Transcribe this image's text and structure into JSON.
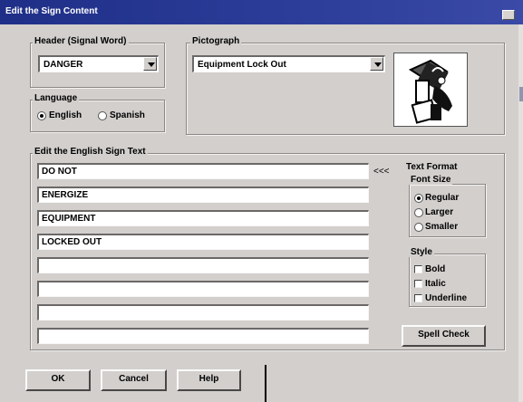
{
  "window": {
    "title": "Edit the Sign Content"
  },
  "header_group": {
    "label": "Header (Signal Word)",
    "value": "DANGER"
  },
  "pictograph_group": {
    "label": "Pictograph",
    "value": "Equipment Lock Out",
    "image_icon": "lockout-hand-padlock-icon"
  },
  "language_group": {
    "label": "Language",
    "options": [
      "English",
      "Spanish"
    ],
    "selected": "English"
  },
  "text_group": {
    "label": "Edit the English Sign Text",
    "marker": "<<<",
    "lines": [
      "DO NOT",
      "ENERGIZE",
      "EQUIPMENT",
      "LOCKED OUT",
      "",
      "",
      "",
      ""
    ]
  },
  "text_format": {
    "title": "Text Format",
    "font_size": {
      "label": "Font Size",
      "options": [
        "Regular",
        "Larger",
        "Smaller"
      ],
      "selected": "Regular"
    },
    "style": {
      "label": "Style",
      "options": [
        "Bold",
        "Italic",
        "Underline"
      ]
    },
    "spell_check": "Spell Check"
  },
  "buttons": {
    "ok": "OK",
    "cancel": "Cancel",
    "help": "Help"
  },
  "colors": {
    "title_bar": "#1f2f88",
    "dialog_bg": "#d2cfcd"
  }
}
